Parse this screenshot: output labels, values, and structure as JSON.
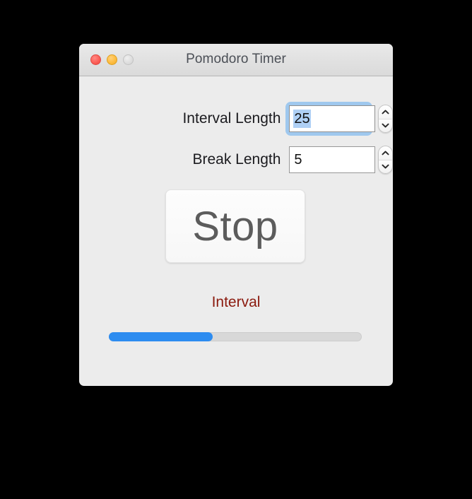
{
  "window": {
    "title": "Pomodoro Timer",
    "controls": {
      "close": "close-button",
      "minimize": "minimize-button",
      "zoom": "zoom-button"
    }
  },
  "form": {
    "interval": {
      "label": "Interval Length",
      "value": "25",
      "focused": true,
      "selected_text": "25",
      "stepper_up": "▲",
      "stepper_down": "▼"
    },
    "break": {
      "label": "Break Length",
      "value": "5",
      "focused": false,
      "stepper_up": "▲",
      "stepper_down": "▼"
    }
  },
  "action": {
    "stop_label": "Stop"
  },
  "status": {
    "phase_label": "Interval",
    "phase_color": "#8b1a0e"
  },
  "progress": {
    "percent": 41,
    "fill_color": "#2d8cf0",
    "track_color": "#d8d8d8"
  },
  "colors": {
    "window_bg": "#ececec",
    "titlebar_top": "#e9e9e9",
    "titlebar_bottom": "#dadada",
    "close": "#fc5f58",
    "minimize": "#fdbc40",
    "zoom": "#dedede",
    "focus_ring": "#9fc8ee",
    "selection": "#afd0f5",
    "desktop_bg": "#000000"
  }
}
